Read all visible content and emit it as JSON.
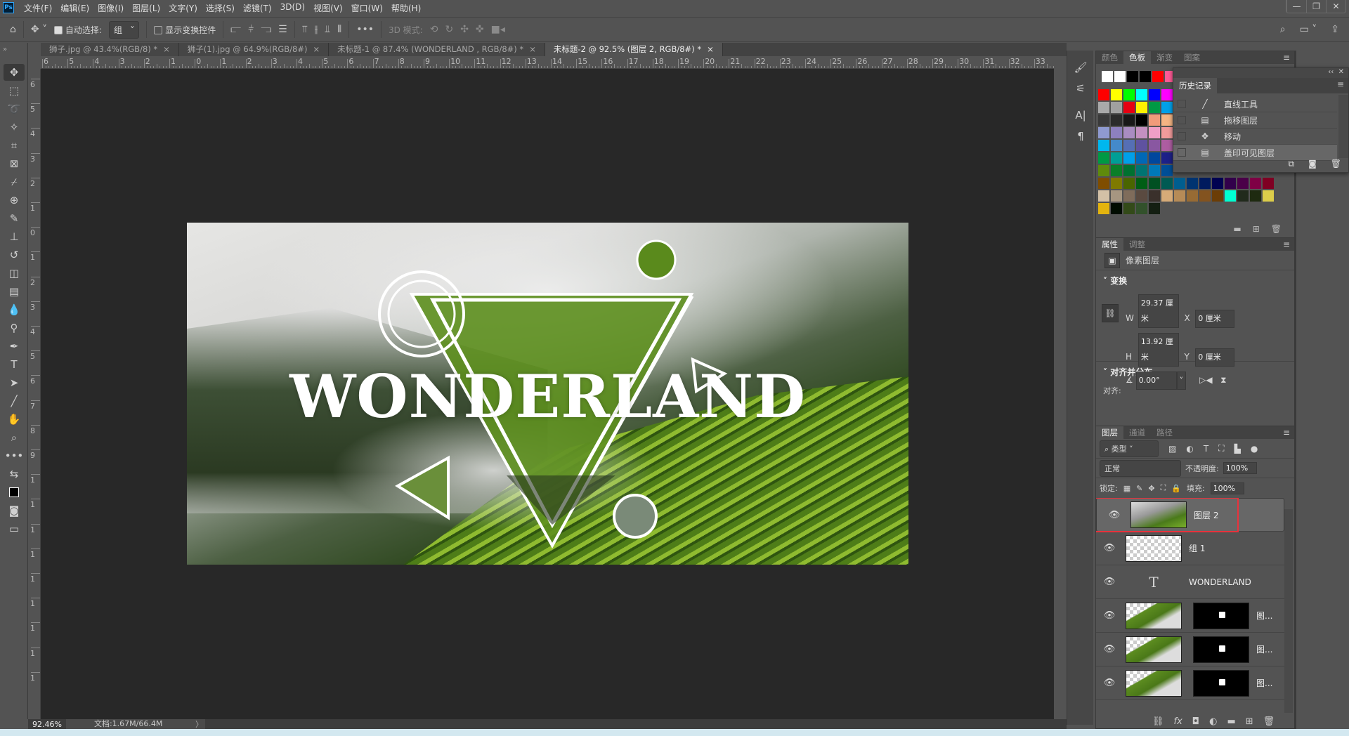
{
  "app": {
    "logo": "Ps",
    "menu": [
      "文件(F)",
      "编辑(E)",
      "图像(I)",
      "图层(L)",
      "文字(Y)",
      "选择(S)",
      "滤镜(T)",
      "3D(D)",
      "视图(V)",
      "窗口(W)",
      "帮助(H)"
    ],
    "window_buttons": [
      "minimize",
      "restore",
      "close"
    ]
  },
  "options": {
    "auto_select_label": "自动选择:",
    "auto_select_checked": true,
    "auto_select_value": "组",
    "show_transform_label": "显示变换控件",
    "show_transform_checked": false,
    "more": "•••",
    "mode_3d_label": "3D 模式:"
  },
  "tabs": [
    {
      "label": "狮子.jpg @ 43.4%(RGB/8) *",
      "active": false
    },
    {
      "label": "狮子(1).jpg @ 64.9%(RGB/8#)",
      "active": false
    },
    {
      "label": "未标题-1 @ 87.4% (WONDERLAND , RGB/8#) *",
      "active": false
    },
    {
      "label": "未标题-2 @ 92.5% (图层 2, RGB/8#) *",
      "active": true
    }
  ],
  "ruler": {
    "top_labels": [
      "6",
      "5",
      "4",
      "3",
      "2",
      "1",
      "0",
      "1",
      "2",
      "3",
      "4",
      "5",
      "6",
      "7",
      "8",
      "9",
      "10",
      "11",
      "12",
      "13",
      "14",
      "15",
      "16",
      "17",
      "18",
      "19",
      "20",
      "21",
      "22",
      "23",
      "24",
      "25",
      "26",
      "27",
      "28",
      "29",
      "30",
      "31",
      "32",
      "33"
    ],
    "left_labels": [
      "6",
      "5",
      "4",
      "3",
      "2",
      "1",
      "0",
      "1",
      "2",
      "3",
      "4",
      "5",
      "6",
      "7",
      "8",
      "9",
      "1",
      "1",
      "1",
      "1",
      "1",
      "1",
      "1",
      "1",
      "1"
    ]
  },
  "artwork": {
    "title": "WONDERLAND"
  },
  "status": {
    "zoom": "92.46%",
    "doc": "文档:1.67M/66.4M",
    "arrow": "〉"
  },
  "swatches": {
    "tabs": [
      "颜色",
      "色板",
      "渐变",
      "图案"
    ],
    "active_tab": "色板",
    "recent": [
      "#ffffff",
      "#ffffff",
      "#000000",
      "#000000",
      "#ff0000",
      "#ff5a96"
    ],
    "rows": [
      [
        "#ff0000",
        "#ffff00",
        "#00ff00",
        "#00ffff",
        "#0000ff",
        "#ff00ff"
      ],
      [
        "#a9a9a9",
        "#a0a0a0",
        "#e60012",
        "#fff100",
        "#009944",
        "#00a0e9"
      ],
      [
        "#3a3a3a",
        "#2b2b2b",
        "#181818",
        "#000000",
        "#f19b7a",
        "#f5b583"
      ],
      [
        "#8f9ad0",
        "#8d80bf",
        "#a98cc1",
        "#c490c0",
        "#f09fc6",
        "#f29b9b"
      ],
      [
        "#00b7ee",
        "#448aca",
        "#556fb5",
        "#5f52a0",
        "#8957a1",
        "#ad5da1"
      ],
      [
        "#009944",
        "#009e96",
        "#00a0e9",
        "#0068b7",
        "#00479d",
        "#1d2088"
      ],
      [
        "#5f8a0c",
        "#0b7e28",
        "#007130",
        "#007472",
        "#0079b8",
        "#004e96"
      ],
      [
        "#7f4d00",
        "#7f7a00",
        "#4a6500",
        "#005e15",
        "#005022",
        "#005a53",
        "#005e8f",
        "#003471",
        "#001b5e",
        "#000251",
        "#32004b",
        "#4b0049",
        "#7f0045",
        "#7f0023"
      ],
      [
        "#d3c1a6",
        "#a69681",
        "#7f6c5b",
        "#5a4a40",
        "#3a302b",
        "#d6ab78",
        "#b68b57",
        "#976b34",
        "#83531f",
        "#6b3d06",
        "#00ffd2",
        "#212a1c",
        "#1e2a10",
        "#dccd4a"
      ],
      [
        "#e3b40f",
        "#000c00",
        "#334a19",
        "#32512b",
        "#141f12"
      ]
    ]
  },
  "history": {
    "title": "历史记录",
    "items": [
      {
        "icon": "line-icon",
        "glyph": "╱",
        "label": "直线工具",
        "active": false
      },
      {
        "icon": "document-icon",
        "glyph": "▤",
        "label": "拖移图层",
        "active": false
      },
      {
        "icon": "move-icon",
        "glyph": "✥",
        "label": "移动",
        "active": false
      },
      {
        "icon": "document-icon",
        "glyph": "▤",
        "label": "盖印可见图层",
        "active": true
      }
    ]
  },
  "properties": {
    "tabs": [
      "属性",
      "调整"
    ],
    "layer_type": "像素图层",
    "transform_label": "变换",
    "w_label": "W",
    "w": "29.37 厘米",
    "h_label": "H",
    "h": "13.92 厘米",
    "x_label": "X",
    "x": "0 厘米",
    "y_label": "Y",
    "y": "0 厘米",
    "angle": "0.00°",
    "align_label": "对齐并分布",
    "align_sub": "对齐:"
  },
  "layers": {
    "tabs": [
      "图层",
      "通道",
      "路径"
    ],
    "filter": "类型",
    "blend": "正常",
    "opacity_label": "不透明度:",
    "opacity": "100%",
    "lock_label": "锁定:",
    "fill_label": "填充:",
    "fill": "100%",
    "items": [
      {
        "name": "图层 2",
        "kind": "pixel",
        "selected": true,
        "visible": true
      },
      {
        "name": "组 1",
        "kind": "group",
        "selected": false,
        "visible": true
      },
      {
        "name": "WONDERLAND",
        "kind": "text",
        "selected": false,
        "visible": true
      },
      {
        "name": "图...",
        "kind": "masked",
        "selected": false,
        "visible": true
      },
      {
        "name": "图...",
        "kind": "masked",
        "selected": false,
        "visible": true
      },
      {
        "name": "图...",
        "kind": "masked",
        "selected": false,
        "visible": true
      }
    ]
  },
  "colors": {
    "highlight": "#e8323c",
    "panel": "#535353",
    "canvas": "#282828"
  }
}
